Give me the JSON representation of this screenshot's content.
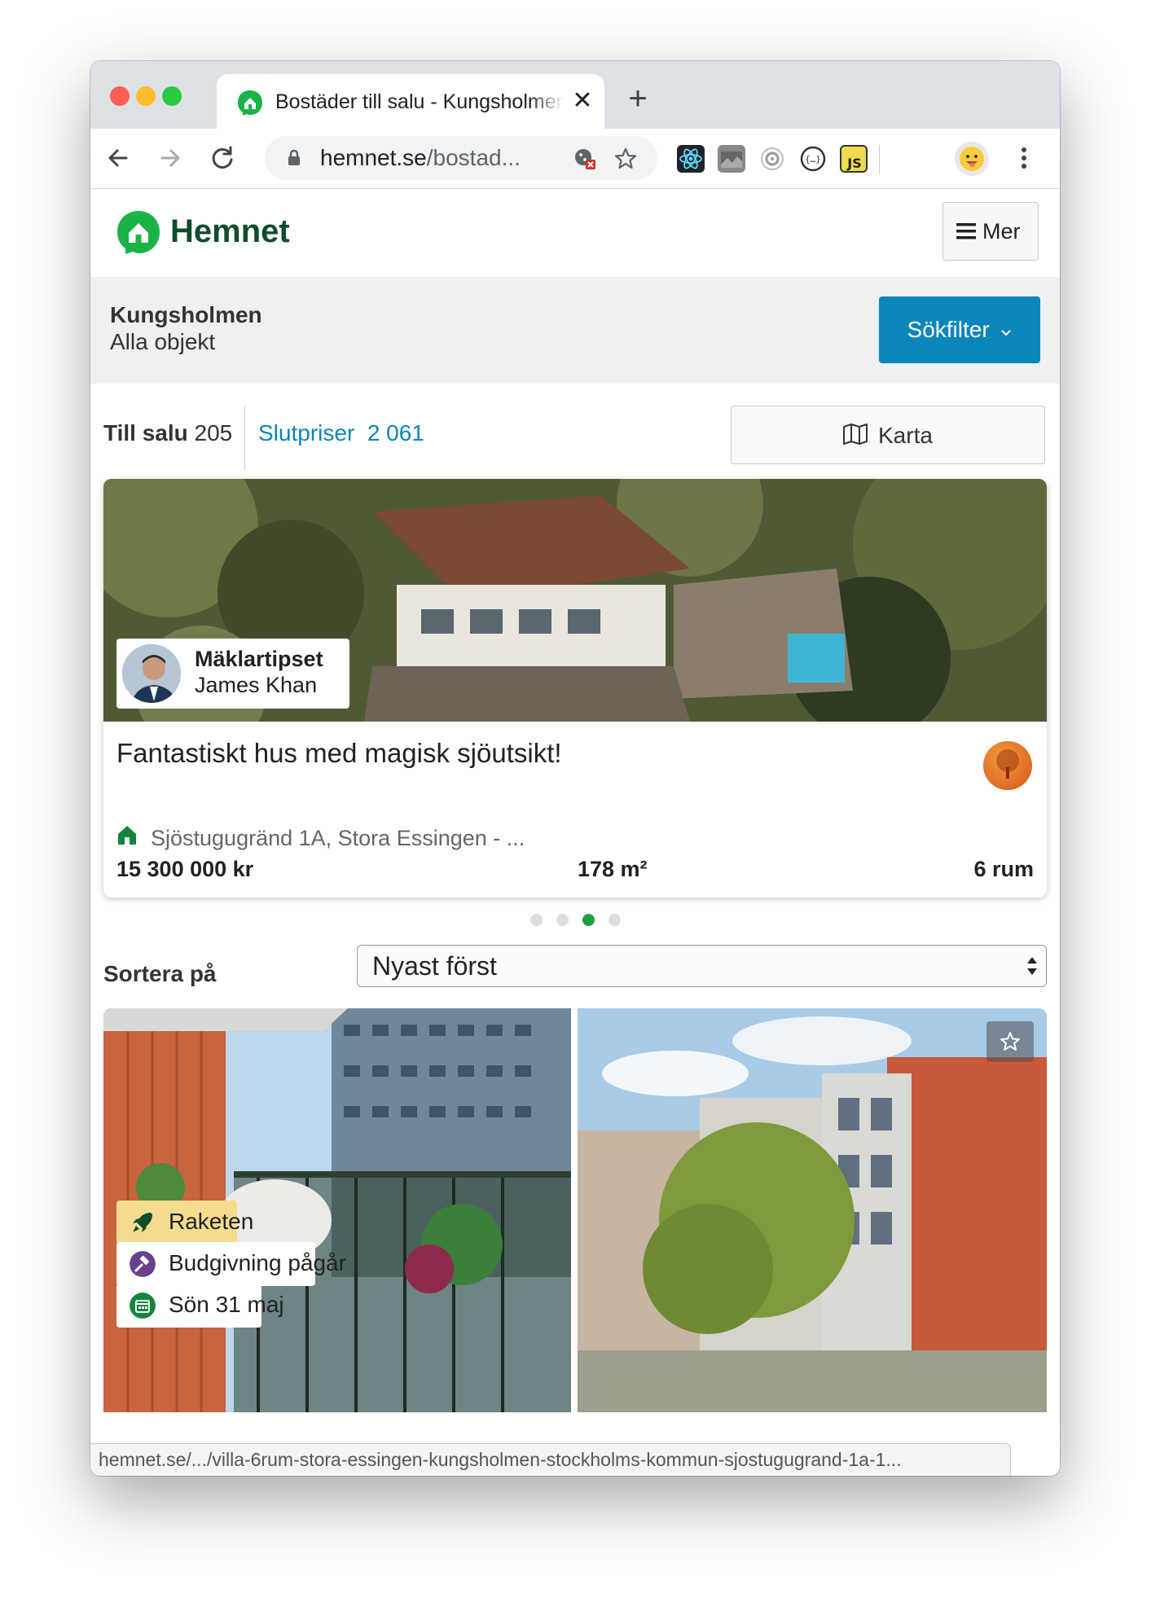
{
  "browser": {
    "tab_title": "Bostäder till salu - Kungsholmen",
    "new_tab_symbol": "+",
    "close_tab_symbol": "✕",
    "url_host": "hemnet.se",
    "url_path": "/bostad...",
    "status_url": "hemnet.se/.../villa-6rum-stora-essingen-kungsholmen-stockholms-kommun-sjostugugrand-1a-1...",
    "icons": [
      "back-icon",
      "forward-icon",
      "reload-icon",
      "lock-icon",
      "cookie-blocked-icon",
      "star-icon",
      "react-devtools-icon",
      "extension-icon",
      "extension-icon",
      "json-extension-icon",
      "js-extension-icon",
      "profile-avatar",
      "more-icon"
    ]
  },
  "header": {
    "logo_text": "Hemnet",
    "menu_label": "Mer",
    "brand_color": "#0f4d2b",
    "logo_green": "#19b347"
  },
  "filter": {
    "location": "Kungsholmen",
    "subtitle": "Alla objekt",
    "button_label": "Sökfilter",
    "button_color": "#0b86b9"
  },
  "tabs": {
    "for_sale_label": "Till salu",
    "for_sale_count": "205",
    "sold_label": "Slutpriser",
    "sold_count": "2 061",
    "map_button": "Karta"
  },
  "featured": {
    "agent_title": "Mäklartipset",
    "agent_name": "James Khan",
    "headline": "Fantastiskt hus med magisk sjöutsikt!",
    "address": "Sjöstugugränd 1A, Stora Essingen - ...",
    "price": "15 300 000 kr",
    "area": "178 m²",
    "rooms": "6 rum",
    "carousel_active_index": 2,
    "carousel_count": 4
  },
  "sort": {
    "label": "Sortera på",
    "selected": "Nyast först"
  },
  "listing": {
    "badges": [
      {
        "label": "Raketen",
        "icon": "rocket-icon",
        "bg": "#f6dc8e"
      },
      {
        "label": "Budgivning pågår",
        "icon": "gavel-icon",
        "bg": "#ffffff"
      },
      {
        "label": "Sön 31 maj",
        "icon": "calendar-icon",
        "bg": "#ffffff"
      }
    ]
  }
}
